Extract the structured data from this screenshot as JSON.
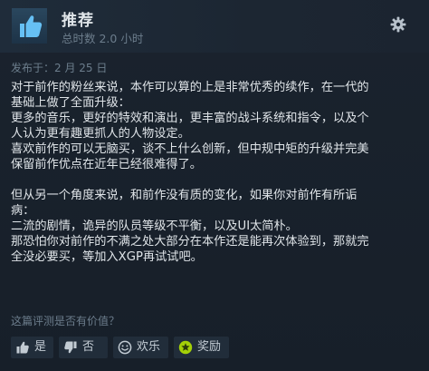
{
  "review": {
    "recommendation": "推荐",
    "hours": "总时数 2.0 小时",
    "posted": "发布于：2 月 25 日",
    "lines": [
      "对于前作的粉丝来说，本作可以算的上是非常优秀的续作，在一代的",
      "基础上做了全面升级：",
      "更多的音乐，更好的特效和演出，更丰富的战斗系统和指令，以及个",
      "人认为更有趣更抓人的人物设定。",
      "喜欢前作的可以无脑买，谈不上什么创新，但中规中矩的升级并完美",
      "保留前作优点在近年已经很难得了。",
      "",
      "但从另一个角度来说，和前作没有质的变化，如果你对前作有所诟",
      "病：",
      "二流的剧情，诡异的队员等级不平衡，以及UI太简朴。",
      "那恐怕你对前作的不满之处大部分在本作还是能再次体验到，那就完",
      "全没必要买，等加入XGP再试试吧。"
    ]
  },
  "helpful": {
    "question": "这篇评测是否有价值？",
    "yes_label": "是",
    "no_label": "否",
    "funny_label": "欢乐",
    "award_label": "奖励"
  },
  "icons": {
    "recommend": "thumbs-up-icon",
    "settings": "gear-icon",
    "yes": "thumbs-up-icon",
    "no": "thumbs-down-icon",
    "funny": "smiley-icon",
    "award": "award-icon"
  },
  "colors": {
    "accent_blue": "#66c0f4",
    "award_green": "#a4d007"
  }
}
